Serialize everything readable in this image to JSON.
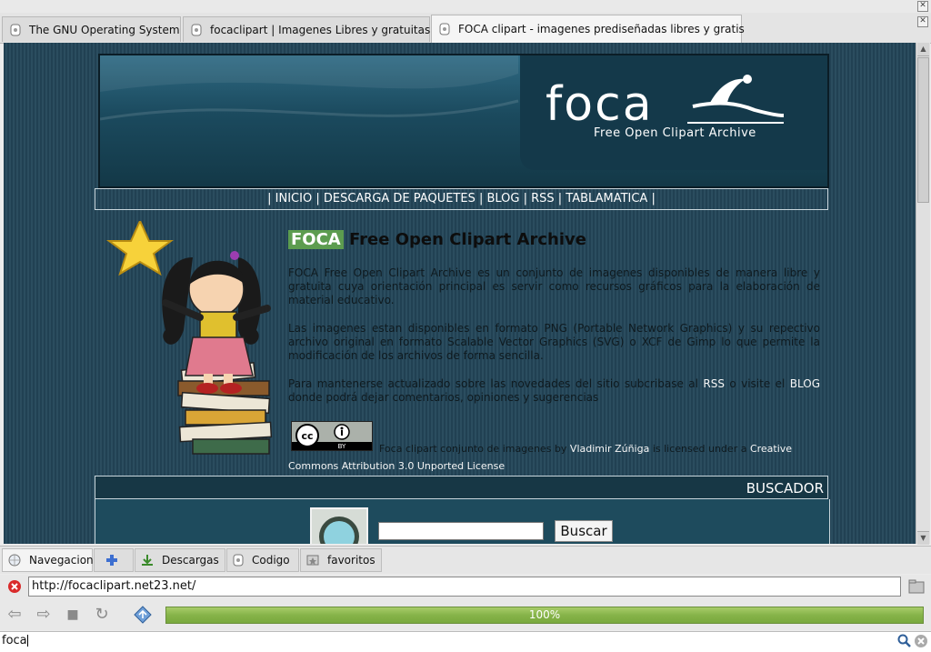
{
  "tabs": [
    {
      "label": "The GNU Operating System"
    },
    {
      "label": "focaclipart | Imagenes Libres y gratuitas"
    },
    {
      "label": "FOCA clipart - imagenes prediseñadas libres y gratis"
    }
  ],
  "page": {
    "logo": "foca",
    "logo_sub": "Free Open Clipart Archive",
    "nav": "| INICIO | DESCARGA DE PAQUETES | BLOG | RSS | TABLAMATICA |",
    "title_tag": "FOCA",
    "title_rest": " Free Open Clipart Archive",
    "para1": "FOCA Free Open Clipart Archive es un conjunto de imagenes disponibles de manera libre y gratuita cuya orientación principal es servir como recursos gráficos para la elaboración de material educativo.",
    "para2": "Las imagenes estan disponibles en formato PNG (Portable Network Graphics) y su repectivo archivo original en formato Scalable Vector Graphics (SVG) o XCF de Gimp lo que permite la modificación de los archivos de forma sencilla.",
    "para3_a": "Para mantenerse actualizado sobre las novedades del sitio subcribase al ",
    "para3_rss": "RSS",
    "para3_b": " o visite el ",
    "para3_blog": "BLOG",
    "para3_c": " donde podrá dejar comentarios, opiniones y sugerencias",
    "cc_badge": "cc BY",
    "license_a": "Foca clipart conjunto de imagenes by ",
    "license_author": "Vladimir Zúñiga",
    "license_b": " is licensed under a ",
    "license_link": "Creative Commons Attribution 3.0 Unported License",
    "buscador": "BUSCADOR",
    "buscar_button": "Buscar",
    "search_value": ""
  },
  "sidebar_tabs": [
    {
      "label": "Navegacion"
    },
    {
      "label": ""
    },
    {
      "label": "Descargas"
    },
    {
      "label": "Codigo"
    },
    {
      "label": "favoritos"
    }
  ],
  "url": "http://focaclipart.net23.net/",
  "progress": {
    "label": "100%",
    "value": 100
  },
  "find": {
    "value": "foca"
  }
}
